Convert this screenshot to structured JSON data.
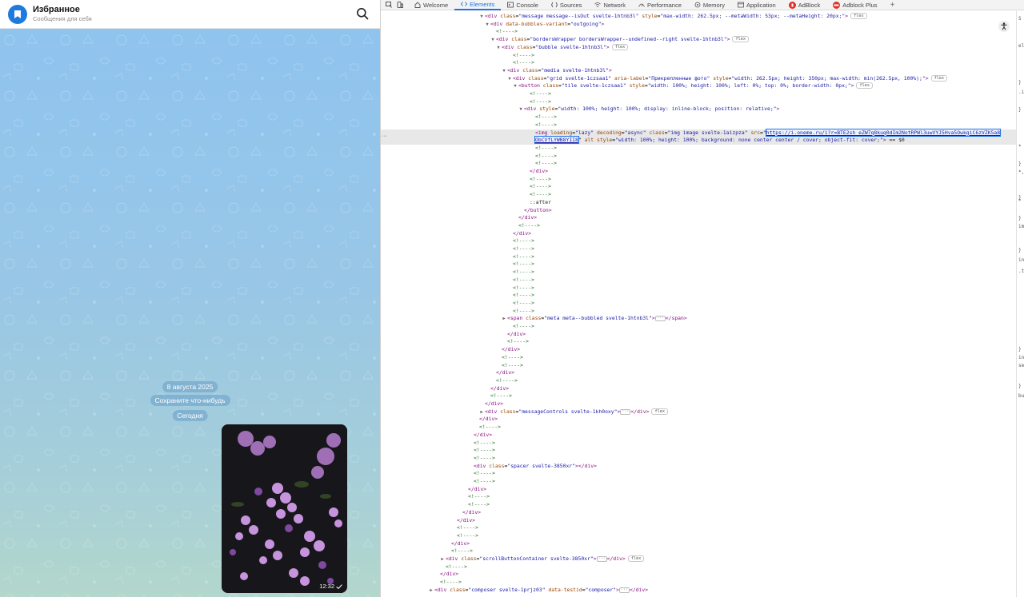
{
  "chat": {
    "title": "Избранное",
    "subtitle": "Сообщения для себя",
    "date_label": "8 августа 2025",
    "hint_label": "Сохраните что-нибудь",
    "today_label": "Сегодня",
    "message": {
      "time": "12:32",
      "status": "read"
    }
  },
  "devtools": {
    "tabs": [
      {
        "label": "Welcome",
        "icon": "home-icon"
      },
      {
        "label": "Elements",
        "icon": "code-icon",
        "active": true
      },
      {
        "label": "Console",
        "icon": "console-icon"
      },
      {
        "label": "Sources",
        "icon": "sources-icon"
      },
      {
        "label": "Network",
        "icon": "wifi-icon"
      },
      {
        "label": "Performance",
        "icon": "performance-icon"
      },
      {
        "label": "Memory",
        "icon": "memory-icon"
      },
      {
        "label": "Application",
        "icon": "application-icon"
      },
      {
        "label": "AdBlock",
        "icon": "adblock-icon"
      },
      {
        "label": "Adblock Plus",
        "icon": "abp-icon"
      }
    ],
    "add_tab": "+",
    "side_chars": [
      "S",
      "el",
      "}",
      ".i",
      "}",
      "*",
      "}",
      "*,",
      "}",
      "*",
      "}",
      "im",
      "}",
      "inl",
      ".t",
      "}",
      "in",
      "se",
      "}",
      "bu"
    ],
    "dom": [
      {
        "i": 18,
        "tw": "d",
        "h": "<span class='tg'>&lt;div</span> <span class='at'>class</span>=<span class='av'>\"message message--isOut svelte-1htnb3l\"</span> <span class='at'>style</span>=<span class='av'>\"max-width: 262.5px; --metaWidth: 53px; --metaHeight: 20px;\"</span><span class='tg'>&gt;</span><span class='chip'>flex</span>"
      },
      {
        "i": 19,
        "tw": "d",
        "h": "<span class='tg'>&lt;div</span> <span class='at'>data-bubbles-variant</span>=<span class='av'>\"outgoing\"</span><span class='tg'>&gt;</span>"
      },
      {
        "i": 20,
        "tw": "",
        "h": "<span class='cm'>&lt;!----&gt;</span>"
      },
      {
        "i": 20,
        "tw": "d",
        "h": "<span class='tg'>&lt;div</span> <span class='at'>class</span>=<span class='av'>\"bordersWrapper bordersWrapper--undefined--right svelte-1htnb3l\"</span><span class='tg'>&gt;</span><span class='chip'>flex</span>"
      },
      {
        "i": 21,
        "tw": "d",
        "h": "<span class='tg'>&lt;div</span> <span class='at'>class</span>=<span class='av'>\"bubble svelte-1htnb3l\"</span><span class='tg'>&gt;</span><span class='chip'>flex</span>"
      },
      {
        "i": 23,
        "tw": "",
        "h": "<span class='cm'>&lt;!----&gt;</span>"
      },
      {
        "i": 23,
        "tw": "",
        "h": "<span class='cm'>&lt;!----&gt;</span>"
      },
      {
        "i": 22,
        "tw": "d",
        "h": "<span class='tg'>&lt;div</span> <span class='at'>class</span>=<span class='av'>\"media svelte-1htnb3l\"</span><span class='tg'>&gt;</span>"
      },
      {
        "i": 23,
        "tw": "d",
        "h": "<span class='tg'>&lt;div</span> <span class='at'>class</span>=<span class='av'>\"grid svelte-1czsaa1\"</span> <span class='at'>aria-label</span>=<span class='av'>\"Прикрепленные фото\"</span> <span class='at'>style</span>=<span class='av'>\"width: 262.5px; height: 350px; max-width: min(262.5px, 100%);\"</span><span class='tg'>&gt;</span><span class='chip'>flex</span>"
      },
      {
        "i": 24,
        "tw": "d",
        "h": "<span class='tg'>&lt;button</span> <span class='at'>class</span>=<span class='av'>\"tile svelte-1czsaa1\"</span> <span class='at'>style</span>=<span class='av'>\"width: 100%; height: 100%; left: 0%; top: 0%; border-width: 0px;\"</span><span class='tg'>&gt;</span><span class='chip'>flex</span>"
      },
      {
        "i": 26,
        "tw": "",
        "h": "<span class='cm'>&lt;!----&gt;</span>"
      },
      {
        "i": 26,
        "tw": "",
        "h": "<span class='cm'>&lt;!----&gt;</span>"
      },
      {
        "i": 25,
        "tw": "d",
        "h": "<span class='tg'>&lt;div</span> <span class='at'>style</span>=<span class='av'>\"width: 100%; height: 100%; display: inline-block; position: relative;\"</span><span class='tg'>&gt;</span>"
      },
      {
        "i": 27,
        "tw": "",
        "h": "<span class='cm'>&lt;!----&gt;</span>"
      },
      {
        "i": 27,
        "tw": "",
        "h": "<span class='cm'>&lt;!----&gt;</span>"
      },
      {
        "i": 27,
        "tw": "",
        "sel": true,
        "h": "<span class='tg'>&lt;img</span> <span class='at'>loading</span>=<span class='av'>\"lazy\"</span> <span class='at'>decoding</span>=<span class='av'>\"async\"</span> <span class='at'>class</span>=<span class='av'>\"img image svelte-1aizpza\"</span> <span class='at'>src</span>=<span class='av'>\"<span class='lk'>https://i.oneme.ru/i?r=BTE2sh_eZW7q8kuq0dIm2NotRPWl3uwVYJ5Hva5OwkgiC6zVZK5a8</span>"
      },
      {
        "i": 27,
        "tw": "",
        "sel": true,
        "h": "<span class='lk'>ObCVfLYWB8YII8</span>\"</span> <span class='at'>alt</span> <span class='at'>style</span>=<span class='av'>\"width: 100%; height: 100%; background: none center center / cover; object-fit: cover;\"</span><span class='tg'>&gt;</span> <span class='tx'>== $0</span>"
      },
      {
        "i": 27,
        "tw": "",
        "h": "<span class='cm'>&lt;!----&gt;</span>"
      },
      {
        "i": 27,
        "tw": "",
        "h": "<span class='cm'>&lt;!----&gt;</span>"
      },
      {
        "i": 27,
        "tw": "",
        "h": "<span class='cm'>&lt;!----&gt;</span>"
      },
      {
        "i": 26,
        "tw": "",
        "h": "<span class='tg'>&lt;/div&gt;</span>"
      },
      {
        "i": 26,
        "tw": "",
        "h": "<span class='cm'>&lt;!----&gt;</span>"
      },
      {
        "i": 26,
        "tw": "",
        "h": "<span class='cm'>&lt;!----&gt;</span>"
      },
      {
        "i": 26,
        "tw": "",
        "h": "<span class='cm'>&lt;!----&gt;</span>"
      },
      {
        "i": 26,
        "tw": "",
        "h": "<span class='tx'>::after</span>"
      },
      {
        "i": 25,
        "tw": "",
        "h": "<span class='tg'>&lt;/button&gt;</span>"
      },
      {
        "i": 24,
        "tw": "",
        "h": "<span class='tg'>&lt;/div&gt;</span>"
      },
      {
        "i": 24,
        "tw": "",
        "h": "<span class='cm'>&lt;!----&gt;</span>"
      },
      {
        "i": 23,
        "tw": "",
        "h": "<span class='tg'>&lt;/div&gt;</span>"
      },
      {
        "i": 23,
        "tw": "",
        "h": "<span class='cm'>&lt;!----&gt;</span>"
      },
      {
        "i": 23,
        "tw": "",
        "h": "<span class='cm'>&lt;!----&gt;</span>"
      },
      {
        "i": 23,
        "tw": "",
        "h": "<span class='cm'>&lt;!----&gt;</span>"
      },
      {
        "i": 23,
        "tw": "",
        "h": "<span class='cm'>&lt;!----&gt;</span>"
      },
      {
        "i": 23,
        "tw": "",
        "h": "<span class='cm'>&lt;!----&gt;</span>"
      },
      {
        "i": 23,
        "tw": "",
        "h": "<span class='cm'>&lt;!----&gt;</span>"
      },
      {
        "i": 23,
        "tw": "",
        "h": "<span class='cm'>&lt;!----&gt;</span>"
      },
      {
        "i": 23,
        "tw": "",
        "h": "<span class='cm'>&lt;!----&gt;</span>"
      },
      {
        "i": 23,
        "tw": "",
        "h": "<span class='cm'>&lt;!----&gt;</span>"
      },
      {
        "i": 23,
        "tw": "",
        "h": "<span class='cm'>&lt;!----&gt;</span>"
      },
      {
        "i": 22,
        "tw": "r",
        "h": "<span class='tg'>&lt;span</span> <span class='at'>class</span>=<span class='av'>\"meta meta--bubbled svelte-1htnb3l\"</span><span class='tg'>&gt;</span><span class='ell'>···</span><span class='tg'>&lt;/span&gt;</span>"
      },
      {
        "i": 23,
        "tw": "",
        "h": "<span class='cm'>&lt;!----&gt;</span>"
      },
      {
        "i": 22,
        "tw": "",
        "h": "<span class='tg'>&lt;/div&gt;</span>"
      },
      {
        "i": 22,
        "tw": "",
        "h": "<span class='cm'>&lt;!----&gt;</span>"
      },
      {
        "i": 21,
        "tw": "",
        "h": "<span class='tg'>&lt;/div&gt;</span>"
      },
      {
        "i": 21,
        "tw": "",
        "h": "<span class='cm'>&lt;!----&gt;</span>"
      },
      {
        "i": 21,
        "tw": "",
        "h": "<span class='cm'>&lt;!----&gt;</span>"
      },
      {
        "i": 20,
        "tw": "",
        "h": "<span class='tg'>&lt;/div&gt;</span>"
      },
      {
        "i": 20,
        "tw": "",
        "h": "<span class='cm'>&lt;!----&gt;</span>"
      },
      {
        "i": 19,
        "tw": "",
        "h": "<span class='tg'>&lt;/div&gt;</span>"
      },
      {
        "i": 19,
        "tw": "",
        "h": "<span class='cm'>&lt;!----&gt;</span>"
      },
      {
        "i": 18,
        "tw": "",
        "h": "<span class='tg'>&lt;/div&gt;</span>"
      },
      {
        "i": 18,
        "tw": "r",
        "h": "<span class='tg'>&lt;div</span> <span class='at'>class</span>=<span class='av'>\"messageControls svelte-1kh0oxy\"</span><span class='tg'>&gt;</span><span class='ell'>···</span><span class='tg'>&lt;/div&gt;</span><span class='chip'>flex</span>"
      },
      {
        "i": 17,
        "tw": "",
        "h": "<span class='tg'>&lt;/div&gt;</span>"
      },
      {
        "i": 17,
        "tw": "",
        "h": "<span class='cm'>&lt;!----&gt;</span>"
      },
      {
        "i": 16,
        "tw": "",
        "h": "<span class='tg'>&lt;/div&gt;</span>"
      },
      {
        "i": 16,
        "tw": "",
        "h": "<span class='cm'>&lt;!----&gt;</span>"
      },
      {
        "i": 16,
        "tw": "",
        "h": "<span class='cm'>&lt;!----&gt;</span>"
      },
      {
        "i": 16,
        "tw": "",
        "h": "<span class='cm'>&lt;!----&gt;</span>"
      },
      {
        "i": 16,
        "tw": "",
        "h": "<span class='tg'>&lt;div</span> <span class='at'>class</span>=<span class='av'>\"spacer svelte-3850xr\"</span><span class='tg'>&gt;&lt;/div&gt;</span>"
      },
      {
        "i": 16,
        "tw": "",
        "h": "<span class='cm'>&lt;!----&gt;</span>"
      },
      {
        "i": 16,
        "tw": "",
        "h": "<span class='cm'>&lt;!----&gt;</span>"
      },
      {
        "i": 15,
        "tw": "",
        "h": "<span class='tg'>&lt;/div&gt;</span>"
      },
      {
        "i": 15,
        "tw": "",
        "h": "<span class='cm'>&lt;!----&gt;</span>"
      },
      {
        "i": 15,
        "tw": "",
        "h": "<span class='cm'>&lt;!----&gt;</span>"
      },
      {
        "i": 14,
        "tw": "",
        "h": "<span class='tg'>&lt;/div&gt;</span>"
      },
      {
        "i": 13,
        "tw": "",
        "h": "<span class='tg'>&lt;/div&gt;</span>"
      },
      {
        "i": 13,
        "tw": "",
        "h": "<span class='cm'>&lt;!----&gt;</span>"
      },
      {
        "i": 13,
        "tw": "",
        "h": "<span class='cm'>&lt;!----&gt;</span>"
      },
      {
        "i": 12,
        "tw": "",
        "h": "<span class='tg'>&lt;/div&gt;</span>"
      },
      {
        "i": 12,
        "tw": "",
        "h": "<span class='cm'>&lt;!----&gt;</span>"
      },
      {
        "i": 11,
        "tw": "r",
        "h": "<span class='tg'>&lt;div</span> <span class='at'>class</span>=<span class='av'>\"scrollButtonContainer svelte-3850xr\"</span><span class='tg'>&gt;</span><span class='ell'>···</span><span class='tg'>&lt;/div&gt;</span><span class='chip'>flex</span>"
      },
      {
        "i": 11,
        "tw": "",
        "h": "<span class='cm'>&lt;!----&gt;</span>"
      },
      {
        "i": 10,
        "tw": "",
        "h": "<span class='tg'>&lt;/div&gt;</span>"
      },
      {
        "i": 10,
        "tw": "",
        "h": "<span class='cm'>&lt;!----&gt;</span>"
      },
      {
        "i": 9,
        "tw": "r",
        "h": "<span class='tg'>&lt;div</span> <span class='at'>class</span>=<span class='av'>\"composer svelte-1prjz03\"</span> <span class='at'>data-testid</span>=<span class='av'>\"composer\"</span><span class='tg'>&gt;</span><span class='ell'>···</span><span class='tg'>&lt;/div&gt;</span>"
      }
    ]
  },
  "colors": {
    "accent": "#1f7ae0",
    "devtools_active": "#1a73e8"
  }
}
